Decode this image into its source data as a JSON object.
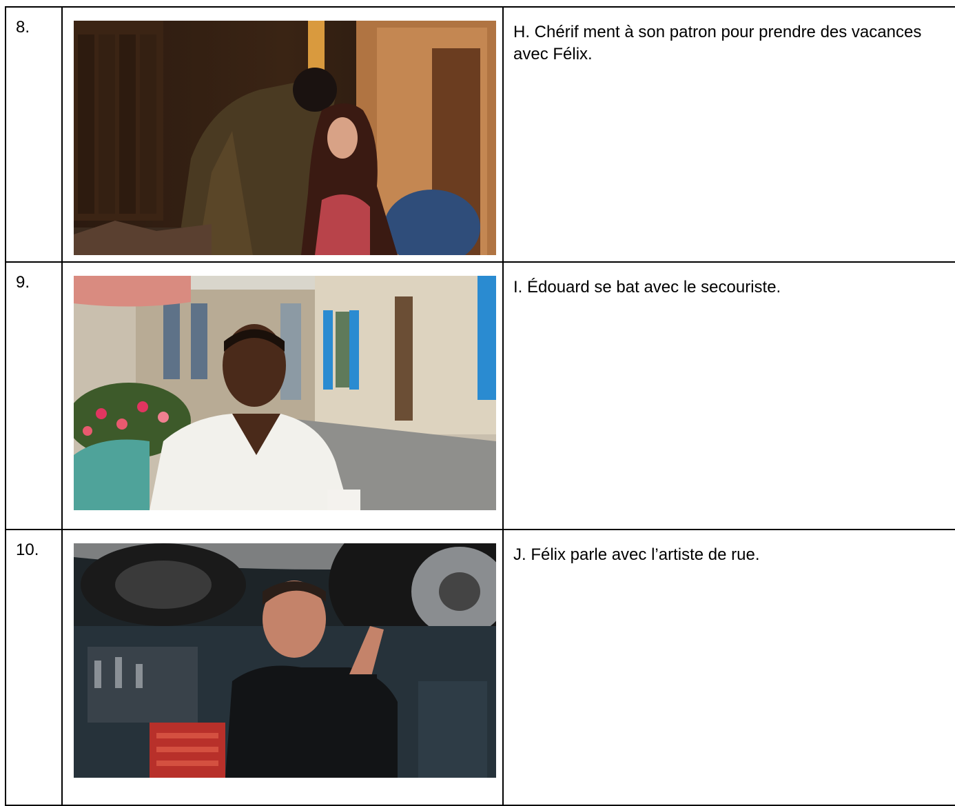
{
  "rows": [
    {
      "number": "8.",
      "statement": "H. Chérif ment à son patron pour prendre des vacances avec Félix."
    },
    {
      "number": "9.",
      "statement": "I. Édouard se bat avec le secouriste."
    },
    {
      "number": "10.",
      "statement": "J. Félix parle avec l’artiste de rue."
    }
  ]
}
